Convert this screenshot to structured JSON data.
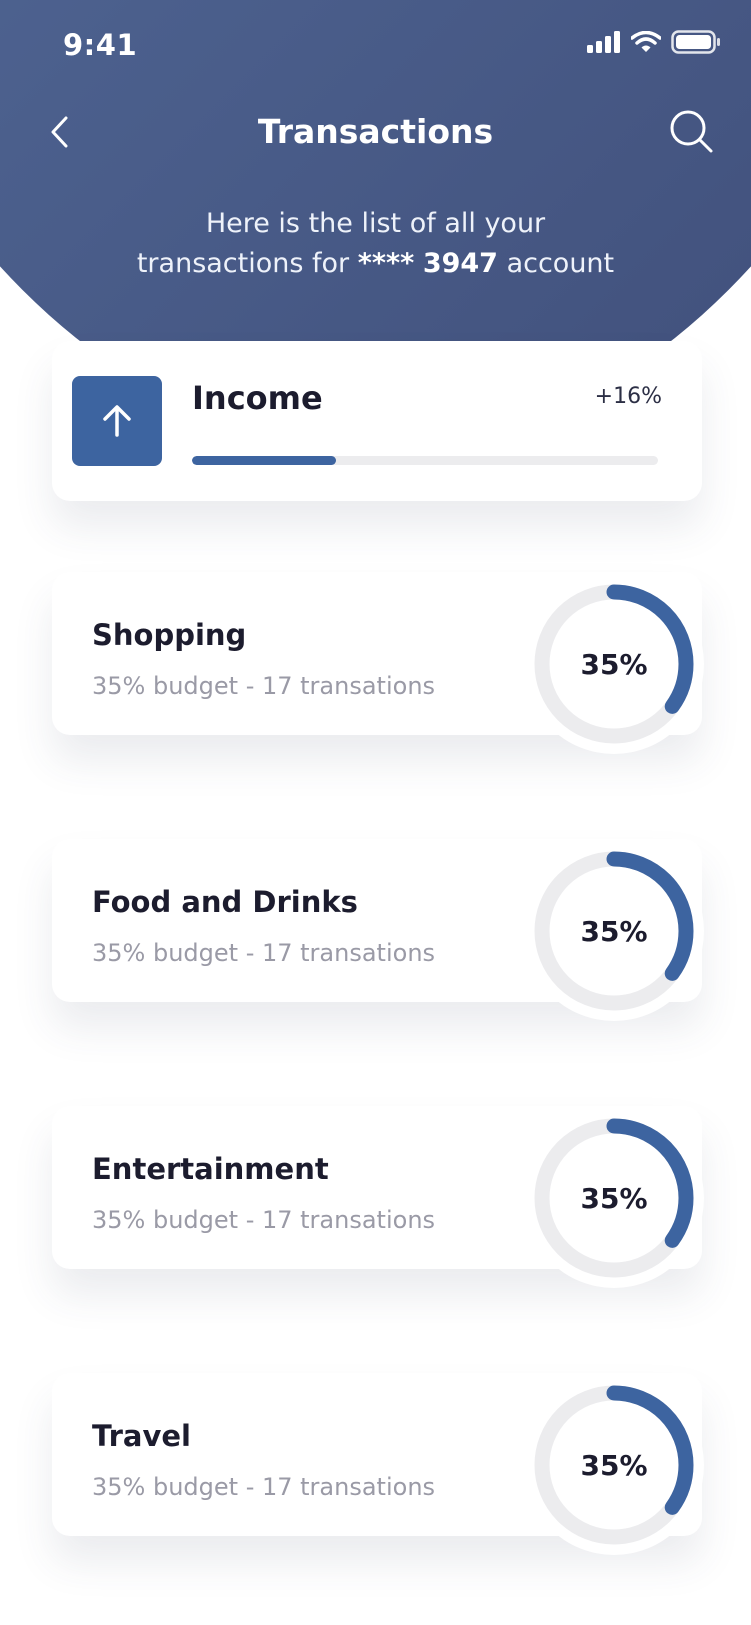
{
  "status_bar": {
    "time": "9:41"
  },
  "header": {
    "title": "Transactions",
    "subtitle_line1": "Here is the list of all your",
    "subtitle_prefix": "transactions for",
    "account_mask": "****",
    "account_number": "3947",
    "subtitle_suffix": "account"
  },
  "income": {
    "label": "Income",
    "change": "+16%",
    "progress_fraction": 0.31
  },
  "categories": [
    {
      "name": "Shopping",
      "subtitle": "35% budget - 17 transations",
      "percent_label": "35%",
      "percent": 35
    },
    {
      "name": "Food and Drinks",
      "subtitle": "35% budget - 17 transations",
      "percent_label": "35%",
      "percent": 35
    },
    {
      "name": "Entertainment",
      "subtitle": "35% budget - 17 transations",
      "percent_label": "35%",
      "percent": 35
    },
    {
      "name": "Travel",
      "subtitle": "35% budget - 17 transations",
      "percent_label": "35%",
      "percent": 35
    }
  ],
  "colors": {
    "accent": "#3d64a0",
    "header_gradient_start": "#6781ac",
    "header_gradient_end": "#3f4d78",
    "track": "#ececee",
    "muted_text": "#9a9aa6"
  },
  "icons": {
    "back": "chevron-left-icon",
    "search": "search-icon",
    "income": "arrow-up-icon",
    "signal": "signal-icon",
    "wifi": "wifi-icon",
    "battery": "battery-icon"
  }
}
